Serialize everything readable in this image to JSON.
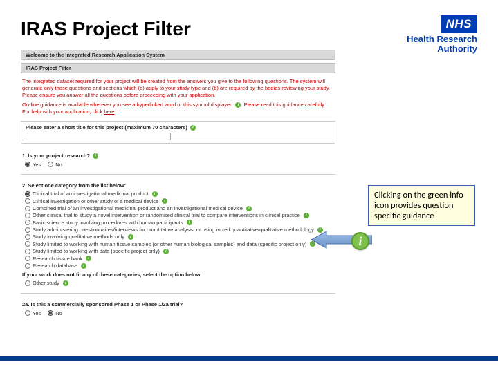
{
  "title": "IRAS Project Filter",
  "logo": {
    "nhs": "NHS",
    "line1": "Health Research",
    "line2": "Authority"
  },
  "panel": {
    "welcome_bar": "Welcome to the Integrated Research Application System",
    "filter_bar": "IRAS Project Filter",
    "intro1": "The integrated dataset required for your project will be created from the answers you give to the following questions. The system will generate only those questions and sections which (a) apply to your study type and (b) are required by the bodies reviewing your study. Please ensure you answer all the questions before proceeding with your application.",
    "intro2_a": "On-line guidance is available wherever you see a hyperlinked word or this symbol displayed ",
    "intro2_b": ". Please read this guidance carefully. For help with your application, click ",
    "intro2_link": "here",
    "intro2_c": ".",
    "short_title_label": "Please enter a short title for this project (maximum 70 characters)",
    "q1": {
      "head": "1. Is your project research?",
      "yes": "Yes",
      "no": "No"
    },
    "q2": {
      "head": "2. Select one category from the list below:",
      "opts": [
        "Clinical trial of an investigational medicinal product",
        "Clinical investigation or other study of a medical device",
        "Combined trial of an investigational medicinal product and an investigational medical device",
        "Other clinical trial to study a novel intervention or randomised clinical trial to compare interventions in clinical practice",
        "Basic science study involving procedures with human participants",
        "Study administering questionnaires/interviews for quantitative analysis, or using mixed quantitative/qualitative methodology",
        "Study involving qualitative methods only",
        "Study limited to working with human tissue samples (or other human biological samples) and data (specific project only)",
        "Study limited to working with data (specific project only)",
        "Research tissue bank",
        "Research database"
      ],
      "none_note": "If your work does not fit any of these categories, select the option below:",
      "other": "Other study"
    },
    "q2a": {
      "head": "2a. Is this a commercially sponsored Phase 1 or Phase 1/2a trial?",
      "yes": "Yes",
      "no": "No"
    }
  },
  "callout": "Clicking on the green info icon provides question specific guidance",
  "big_info": "i"
}
